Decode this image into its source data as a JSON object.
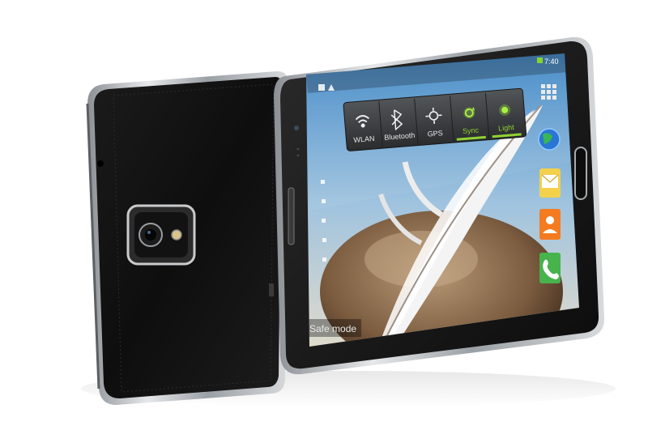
{
  "status_bar": {
    "time": "7:40"
  },
  "quick_settings": [
    {
      "label": "WLAN",
      "icon": "wifi-icon",
      "active": false
    },
    {
      "label": "Bluetooth",
      "icon": "bluetooth-icon",
      "active": false
    },
    {
      "label": "GPS",
      "icon": "gps-icon",
      "active": false
    },
    {
      "label": "Sync",
      "icon": "sync-icon",
      "active": true
    },
    {
      "label": "Light",
      "icon": "light-icon",
      "active": true
    }
  ],
  "overlay": {
    "safe_mode": "Safe mode"
  },
  "dock_icons": [
    "grid-apps-icon",
    "globe-browser-icon",
    "envelope-email-icon",
    "contacts-icon",
    "phone-icon"
  ],
  "colors": {
    "active_green": "#8bd12a",
    "inactive_label": "#e8e8e8",
    "phone_body": "#141414",
    "chrome": "#b9bcbf"
  }
}
